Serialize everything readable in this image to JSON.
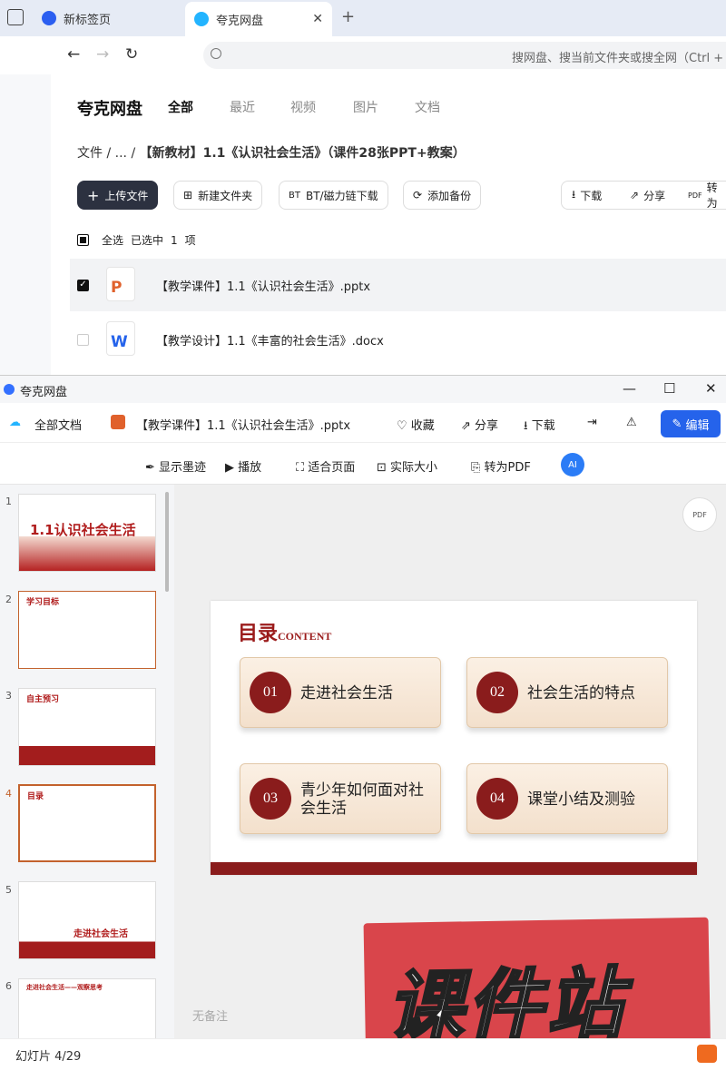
{
  "browser": {
    "tabs": [
      {
        "label": "新标签页"
      },
      {
        "label": "夸克网盘"
      }
    ],
    "address_placeholder": "搜网盘、搜当前文件夹或搜全网（Ctrl + F）"
  },
  "drive": {
    "brand": "夸克网盘",
    "filter_tabs": [
      "全部",
      "最近",
      "视频",
      "图片",
      "文档"
    ],
    "breadcrumb": {
      "root": "文件",
      "sep1": "/",
      "ellipsis": "...",
      "sep2": "/",
      "current": "【新教材】1.1《认识社会生活》（课件28张PPT+教案）"
    },
    "toolbar": {
      "upload": "上传文件",
      "new_folder": "新建文件夹",
      "bt": "BT/磁力链下载",
      "backup": "添加备份",
      "download": "下载",
      "share": "分享",
      "convert": "转为"
    },
    "selection": {
      "select_all": "全选",
      "selected": "已选中",
      "count": "1",
      "unit": "项"
    },
    "files": [
      {
        "name": "【教学课件】1.1《认识社会生活》.pptx",
        "type": "P",
        "checked": true
      },
      {
        "name": "【教学设计】1.1《丰富的社会生活》.docx",
        "type": "W",
        "checked": false
      }
    ]
  },
  "viewer": {
    "window_title": "夸克网盘",
    "all_docs": "全部文档",
    "file_name": "【教学课件】1.1《认识社会生活》.pptx",
    "actions": {
      "favorite": "收藏",
      "share": "分享",
      "download": "下载",
      "edit": "编辑"
    },
    "tools": {
      "ink": "显示墨迹",
      "play": "播放",
      "fit": "适合页面",
      "actual": "实际大小",
      "pdf": "转为PDF",
      "ai": "AI"
    },
    "thumbnails": [
      {
        "n": "1",
        "caption": "1.1认识社会生活"
      },
      {
        "n": "2",
        "caption": "学习目标"
      },
      {
        "n": "3",
        "caption": "自主预习"
      },
      {
        "n": "4",
        "caption": "目录"
      },
      {
        "n": "5",
        "caption": "走进社会生活"
      },
      {
        "n": "6",
        "caption": "走进社会生活——观察思考"
      }
    ],
    "slide": {
      "title": "目录",
      "title_en": "CONTENT",
      "items": [
        {
          "num": "01",
          "text": "走进社会生活"
        },
        {
          "num": "02",
          "text": "社会生活的特点"
        },
        {
          "num": "03",
          "text": "青少年如何面对社会生活"
        },
        {
          "num": "04",
          "text": "课堂小结及测验"
        }
      ]
    },
    "notes": "无备注",
    "status": "幻灯片 4/29",
    "pdf_icon": "PDF",
    "watermark": "课件站"
  },
  "colors": {
    "accent": "#2563eb",
    "slide_red": "#8a1c1c",
    "stamp": "#d9454b"
  }
}
